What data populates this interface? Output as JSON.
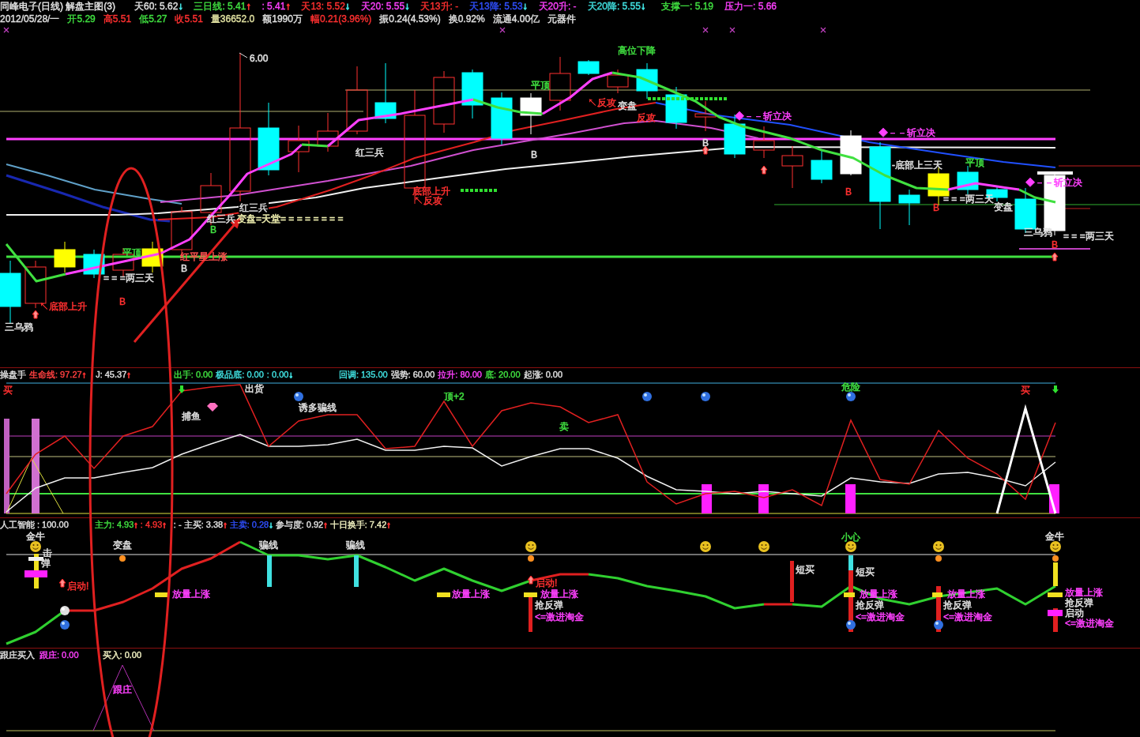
{
  "header": {
    "title": "同峰电子(日线) 解盘主图(3)",
    "indicators": [
      {
        "text": "天60: 5.62",
        "color": "#e0e0e0",
        "arrow": {
          "glyph": "↓",
          "color": "#40e0e0"
        }
      },
      {
        "text": "三日线: 5.41",
        "color": "#40e040",
        "arrow": {
          "glyph": "↑",
          "color": "#ff3030"
        }
      },
      {
        "text": ": 5.41",
        "color": "#ff40ff",
        "arrow": {
          "glyph": "↑",
          "color": "#ff3030"
        }
      },
      {
        "text": "天13: 5.52",
        "color": "#ff3030",
        "arrow": {
          "glyph": "↓",
          "color": "#40e0e0"
        }
      },
      {
        "text": "天20: 5.55",
        "color": "#ff40ff",
        "arrow": {
          "glyph": "↓",
          "color": "#40e0e0"
        }
      },
      {
        "text": "天13升: -",
        "color": "#ff3030"
      },
      {
        "text": "天13降: 5.53",
        "color": "#3050ff",
        "arrow": {
          "glyph": "↓",
          "color": "#40e0e0"
        }
      },
      {
        "text": "天20升: -",
        "color": "#ff40ff"
      },
      {
        "text": "天20降: 5.55",
        "color": "#40e0e0",
        "arrow": {
          "glyph": "↓",
          "color": "#40e0e0"
        }
      },
      {
        "text": "支撑一: 5.19",
        "color": "#40e040"
      },
      {
        "text": "压力一: 5.66",
        "color": "#ff40ff"
      }
    ],
    "quote": [
      {
        "text": "2012/05/28/一",
        "color": "#e0e0e0"
      },
      {
        "text": "开5.29",
        "color": "#40e040"
      },
      {
        "text": "高5.51",
        "color": "#ff3030"
      },
      {
        "text": "低5.27",
        "color": "#40e040"
      },
      {
        "text": "收5.51",
        "color": "#ff3030"
      },
      {
        "text": "量36652.0",
        "color": "#e0e0a0"
      },
      {
        "text": "额1990万",
        "color": "#e0e0e0"
      },
      {
        "text": "幅0.21(3.96%)",
        "color": "#ff3030"
      },
      {
        "text": "振0.24(4.53%)",
        "color": "#e0e0e0"
      },
      {
        "text": "换0.92%",
        "color": "#e0e0e0"
      },
      {
        "text": "流通4.00亿",
        "color": "#e0e0e0"
      },
      {
        "text": "元器件",
        "color": "#e0e0e0"
      }
    ]
  },
  "main_chart": {
    "labels": [
      {
        "text": "高位下降",
        "color": "#40e040"
      },
      {
        "text": "6.00",
        "color": "#e0e0e0"
      },
      {
        "text": "平顶",
        "color": "#40e040"
      },
      {
        "text": "↖反攻",
        "color": "#ff3030"
      },
      {
        "text": "变盘",
        "color": "#e0e0e0"
      },
      {
        "text": "反攻",
        "color": "#ff3030"
      },
      {
        "text": "◆－－斩立决",
        "color": "#ff40ff"
      },
      {
        "text": "◆－－斩立决",
        "color": "#ff40ff"
      },
      {
        "text": "B",
        "color": "#e0e0e0"
      },
      {
        "text": "红三兵",
        "color": "#e0e0e0"
      },
      {
        "text": "B",
        "color": "#e0e0e0"
      },
      {
        "text": "-底部上三天",
        "color": "#e0e0e0"
      },
      {
        "text": "平顶",
        "color": "#40e040"
      },
      {
        "text": "◆－－斩立决",
        "color": "#ff40ff"
      },
      {
        "text": "底部上升",
        "color": "#ff3030"
      },
      {
        "text": "B",
        "color": "#ff3030"
      },
      {
        "text": "↖反攻",
        "color": "#ff3030"
      },
      {
        "text": "= = =两三天",
        "color": "#e0e0e0"
      },
      {
        "text": "红三兵",
        "color": "#e0e0e0"
      },
      {
        "text": "B",
        "color": "#ff3030"
      },
      {
        "text": "变盘",
        "color": "#e0e0e0"
      },
      {
        "text": "红三兵",
        "color": "#e0e0e0"
      },
      {
        "text": "变盘=天堂= = = = = = = =",
        "color": "#f0f0b0"
      },
      {
        "text": "B",
        "color": "#40e040"
      },
      {
        "text": "三乌鸦",
        "color": "#e0e0e0"
      },
      {
        "text": "= = =两三天",
        "color": "#e0e0e0"
      },
      {
        "text": "B",
        "color": "#ff3030"
      },
      {
        "text": "平顶",
        "color": "#40e040"
      },
      {
        "text": "红平星上涨",
        "color": "#ff5050"
      },
      {
        "text": "B",
        "color": "#e0e0e0"
      },
      {
        "text": "= = =两三天",
        "color": "#e0e0e0"
      },
      {
        "text": "↖底部上升",
        "color": "#ff3030"
      },
      {
        "text": "B",
        "color": "#ff3030"
      },
      {
        "text": "三乌鸦",
        "color": "#e0e0e0"
      }
    ]
  },
  "panels": [
    {
      "name": "操盘手",
      "readings": [
        {
          "text": "生命线: 97.27",
          "color": "#ff4040",
          "arrow": {
            "glyph": "↑",
            "color": "#ff3030"
          }
        },
        {
          "text": "J: 45.37",
          "color": "#e0e0e0",
          "arrow": {
            "glyph": "↑",
            "color": "#ff3030"
          }
        },
        {
          "text": "出手: 0.00",
          "color": "#40e040"
        },
        {
          "text": "极品底: 0.00",
          "color": "#40e0e0"
        },
        {
          "text": ": 0.00",
          "color": "#40e0e0",
          "arrow": {
            "glyph": "↓",
            "color": "#40e0e0"
          }
        },
        {
          "text": "回调: 135.00",
          "color": "#40e0e0"
        },
        {
          "text": "强势: 60.00",
          "color": "#e0e0e0"
        },
        {
          "text": "拉升: 80.00",
          "color": "#ff40ff"
        },
        {
          "text": "底: 20.00",
          "color": "#40e040"
        },
        {
          "text": "起涨: 0.00",
          "color": "#e0e0e0"
        }
      ],
      "labels": [
        {
          "text": "买",
          "color": "#ff3030"
        },
        {
          "text": "捕鱼",
          "color": "#e0e0e0"
        },
        {
          "text": "出货",
          "color": "#e0e0e0"
        },
        {
          "text": "诱多骗线",
          "color": "#e0e0e0"
        },
        {
          "text": "顶+2",
          "color": "#40e040"
        },
        {
          "text": "卖",
          "color": "#40e040"
        },
        {
          "text": "危险",
          "color": "#40e040"
        },
        {
          "text": "买",
          "color": "#ff3030"
        }
      ]
    },
    {
      "name": "人工智能",
      "readings": [
        {
          "text": ": 100.00",
          "color": "#e0e0e0"
        },
        {
          "text": "主力: 4.93",
          "color": "#40e040",
          "arrow": {
            "glyph": "↑",
            "color": "#ff3030"
          }
        },
        {
          "text": ": 4.93",
          "color": "#ff3030",
          "arrow": {
            "glyph": "↑",
            "color": "#ff3030"
          }
        },
        {
          "text": ": - 主买: 3.38",
          "color": "#e0e0e0",
          "arrow": {
            "glyph": "↑",
            "color": "#ff3030"
          }
        },
        {
          "text": "主卖: 0.28",
          "color": "#3050ff",
          "arrow": {
            "glyph": "↓",
            "color": "#40e0e0"
          }
        },
        {
          "text": "参与度: 0.92",
          "color": "#e0e0e0",
          "arrow": {
            "glyph": "↑",
            "color": "#ff3030"
          }
        },
        {
          "text": "十日换手: 7.42",
          "color": "#f0f0c0",
          "arrow": {
            "glyph": "↑",
            "color": "#ff3030"
          }
        }
      ],
      "labels": [
        {
          "text": "金牛",
          "color": "#e0e0e0"
        },
        {
          "text": "击",
          "color": "#e0e0e0"
        },
        {
          "text": "弹",
          "color": "#e0e0e0"
        },
        {
          "text": "启动!",
          "color": "#ff3030"
        },
        {
          "text": "变盘",
          "color": "#e0e0e0"
        },
        {
          "text": "放量上涨",
          "color": "#ff40ff"
        },
        {
          "text": "骗线",
          "color": "#e0e0e0"
        },
        {
          "text": "骗线",
          "color": "#e0e0e0"
        },
        {
          "text": "放量上涨",
          "color": "#ff40ff"
        },
        {
          "text": "启动!",
          "color": "#ff3030"
        },
        {
          "text": "放量上涨",
          "color": "#ff40ff"
        },
        {
          "text": "抢反弹",
          "color": "#e0e0e0"
        },
        {
          "text": "<=激进淘金",
          "color": "#ff40ff"
        },
        {
          "text": "短买",
          "color": "#e0e0e0"
        },
        {
          "text": "小心",
          "color": "#40e040"
        },
        {
          "text": "短买",
          "color": "#e0e0e0"
        },
        {
          "text": "放量上涨",
          "color": "#ff40ff"
        },
        {
          "text": "抢反弹",
          "color": "#e0e0e0"
        },
        {
          "text": "<=激进淘金",
          "color": "#ff40ff"
        },
        {
          "text": "放量上涨",
          "color": "#ff40ff"
        },
        {
          "text": "抢反弹",
          "color": "#e0e0e0"
        },
        {
          "text": "<=激进淘金",
          "color": "#ff40ff"
        },
        {
          "text": "金牛",
          "color": "#e0e0e0"
        },
        {
          "text": "放量上涨",
          "color": "#ff40ff"
        },
        {
          "text": "抢反弹",
          "color": "#e0e0e0"
        },
        {
          "text": "启动",
          "color": "#e0e0e0"
        },
        {
          "text": "<=激进淘金",
          "color": "#ff40ff"
        }
      ]
    },
    {
      "name": "跟庄买入",
      "readings": [
        {
          "text": "跟庄: 0.00",
          "color": "#ff40ff"
        },
        {
          "text": "买入: 0.00",
          "color": "#f0f0c0"
        }
      ],
      "labels": [
        {
          "text": "跟庄",
          "color": "#ff40ff"
        }
      ]
    }
  ]
}
